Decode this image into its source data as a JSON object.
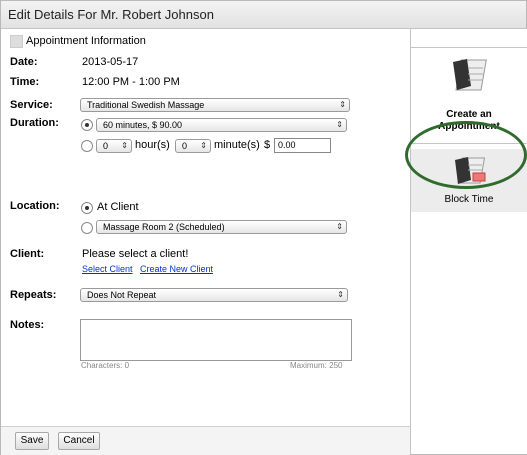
{
  "window": {
    "title": "Edit Details For Mr. Robert Johnson"
  },
  "form": {
    "appointment_info_label": "Appointment Information",
    "date_label": "Date:",
    "date_value": "2013-05-17",
    "time_label": "Time:",
    "time_value": "12:00 PM - 1:00 PM",
    "service_label": "Service:",
    "service_value": "Traditional Swedish Massage",
    "duration_label": "Duration:",
    "duration_option": "60 minutes, $ 90.00",
    "custom_hours_value": "0",
    "hours_label": "hour(s)",
    "custom_minutes_value": "0",
    "minutes_label": "minute(s)",
    "price_prefix": "$",
    "price_value": "0.00",
    "location_label": "Location:",
    "location_client": "At Client",
    "location_room": "Massage Room 2 (Scheduled)",
    "client_label": "Client:",
    "client_prompt": "Please select a client!",
    "select_client_link": "Select Client",
    "create_client_link": "Create New Client",
    "repeats_label": "Repeats:",
    "repeats_value": "Does Not Repeat",
    "notes_label": "Notes:",
    "characters_text": "Characters: 0",
    "maximum_text": "Maximum: 250"
  },
  "footer": {
    "save_label": "Save",
    "cancel_label": "Cancel"
  },
  "sidebar": {
    "create_line1": "Create an",
    "create_line2": "Appointment",
    "block_label": "Block Time",
    "highlight_color": "#2f6b2d"
  }
}
